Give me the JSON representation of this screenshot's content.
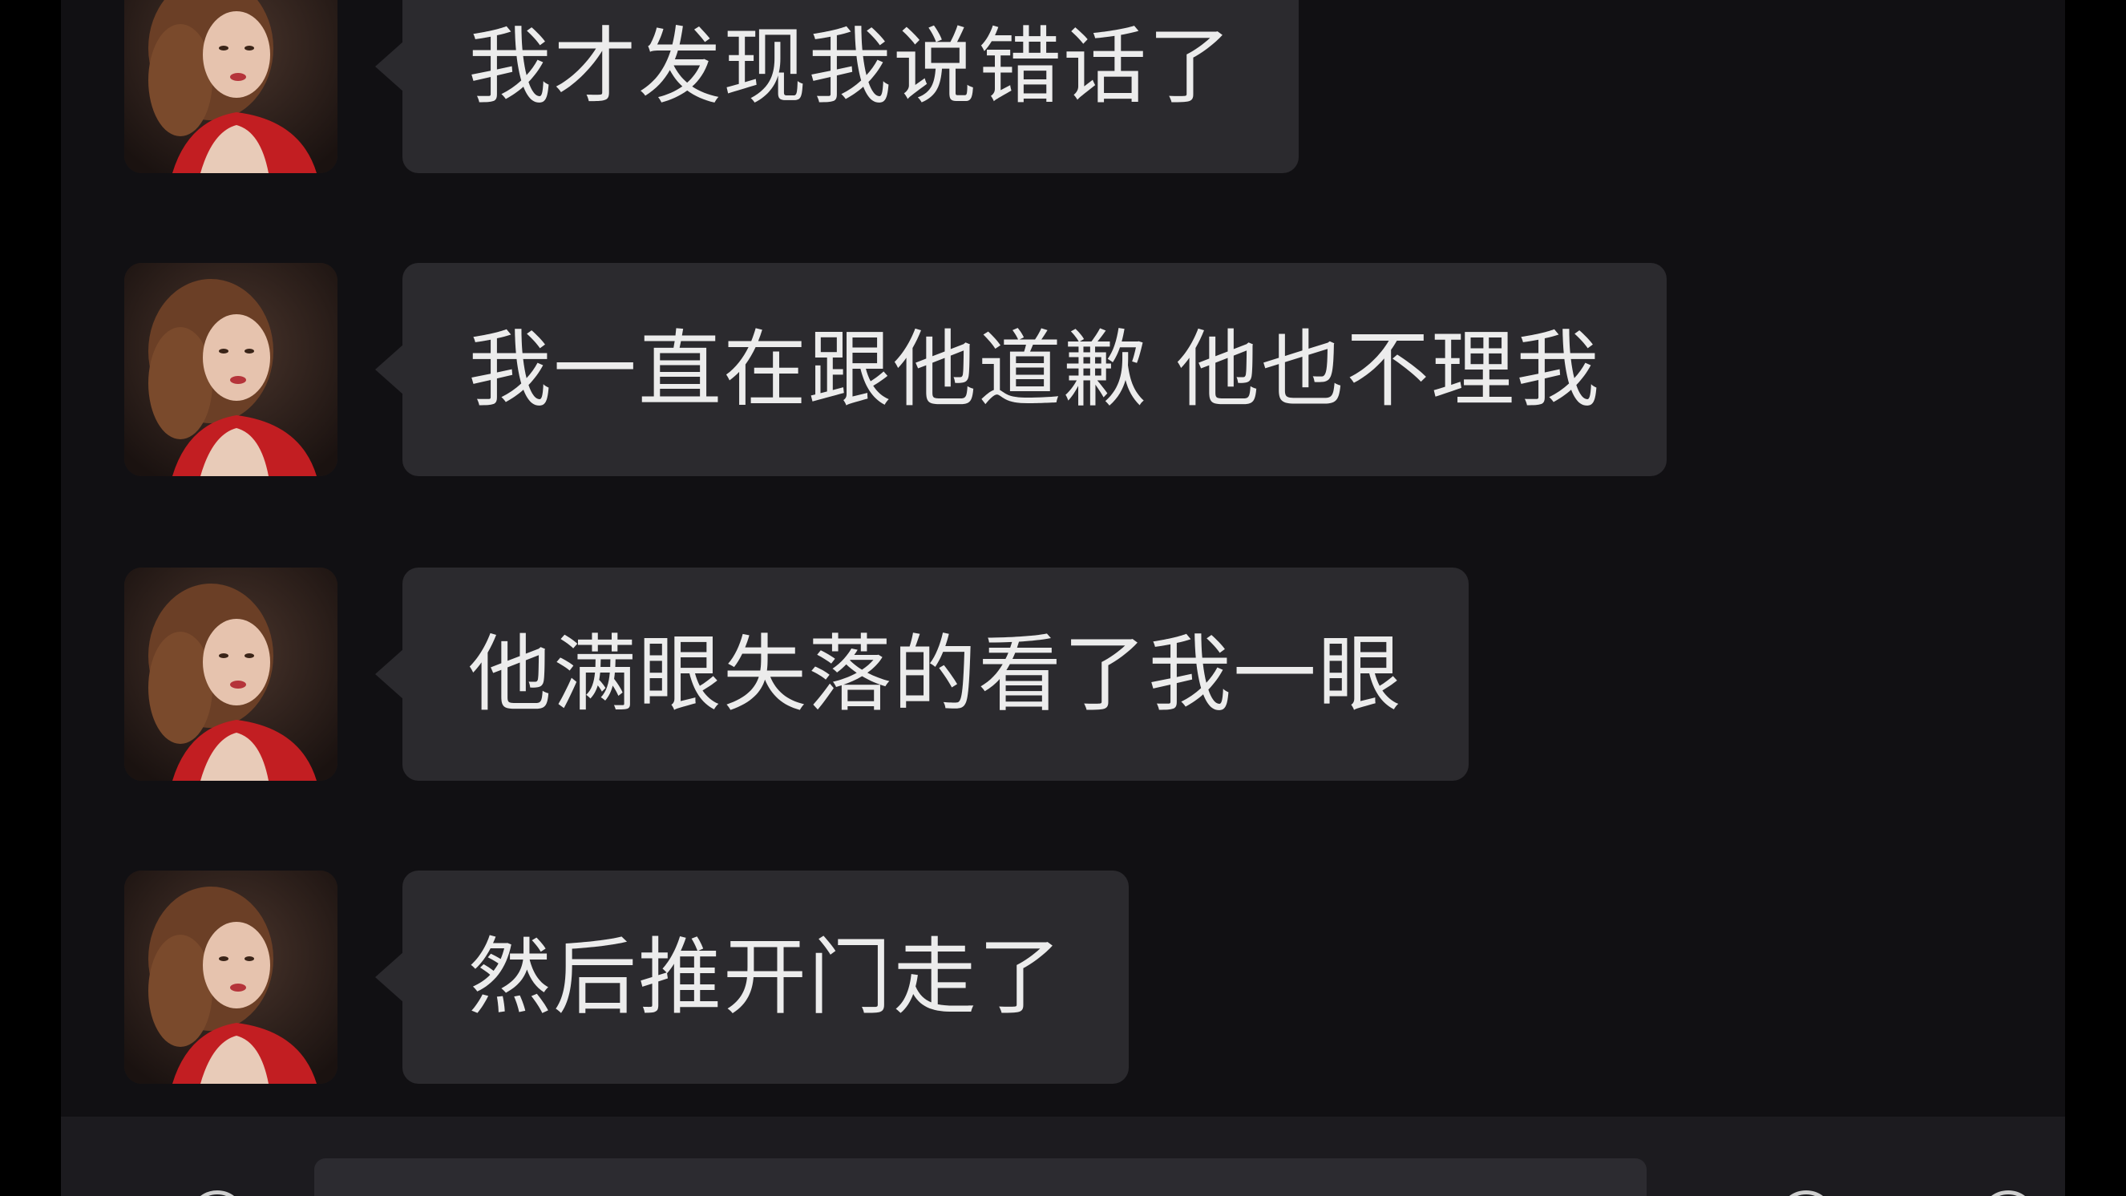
{
  "chat": {
    "messages": [
      {
        "sender": "other",
        "avatar_icon": "avatar-photo-icon",
        "text": "我才发现我说错话了"
      },
      {
        "sender": "other",
        "avatar_icon": "avatar-photo-icon",
        "text": "我一直在跟他道歉 他也不理我"
      },
      {
        "sender": "other",
        "avatar_icon": "avatar-photo-icon",
        "text": "他满眼失落的看了我一眼"
      },
      {
        "sender": "other",
        "avatar_icon": "avatar-photo-icon",
        "text": "然后推开门走了"
      }
    ]
  },
  "composer": {
    "input_value": "",
    "left_icon": "voice-icon",
    "right_icons": [
      "emoji-icon",
      "plus-icon"
    ]
  },
  "colors": {
    "background": "#111013",
    "bubble": "#2b2a2e",
    "text": "#ececec",
    "composer": "#1c1b1f"
  }
}
